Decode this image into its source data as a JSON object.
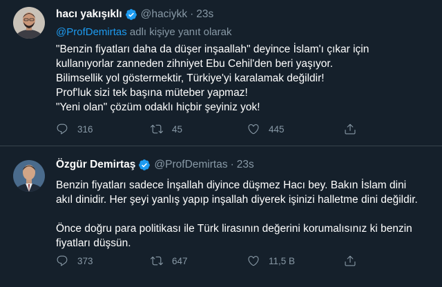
{
  "tweets": [
    {
      "name": "hacı yakışıklı",
      "handle": "@haciykk",
      "separator": "·",
      "time": "23s",
      "replying_to": {
        "mention": "@ProfDemirtas",
        "suffix": " adlı kişiye yanıt olarak"
      },
      "lines": [
        "\"Benzin fiyatları daha da düşer inşaallah\" deyince İslam'ı çıkar için",
        "kullanıyorlar zanneden zihniyet Ebu Cehil'den beri yaşıyor.",
        "Bilimsellik yol göstermektir, Türkiye'yi karalamak değildir!",
        "Prof'luk sizi tek başına müteber yapmaz!",
        "\"Yeni olan\" çözüm odaklı hiçbir şeyiniz yok!"
      ],
      "actions": {
        "replies": "316",
        "retweets": "45",
        "likes": "445"
      }
    },
    {
      "name": "Özgür Demirtaş",
      "handle": "@ProfDemirtas",
      "separator": "·",
      "time": "23s",
      "lines": [
        "Benzin fiyatları sadece İnşallah diyince düşmez Hacı bey. Bakın İslam dini",
        "akıl dinidir. Her şeyi yanlış yapıp inşallah diyerek işinizi halletme dini değildir.",
        "",
        "Önce doğru para politikası ile Türk lirasının değerini korumalısınız ki benzin",
        "fiyatları düşsün."
      ],
      "actions": {
        "replies": "373",
        "retweets": "647",
        "likes": "11,5 B"
      }
    }
  ],
  "colors": {
    "background": "#15202b",
    "text": "#ffffff",
    "secondary": "#8899a6",
    "link": "#1d9bf0",
    "verified": "#1d9bf0",
    "divider": "#38444d"
  },
  "icons": [
    "verified-badge-icon",
    "reply-icon",
    "retweet-icon",
    "like-icon",
    "share-icon"
  ]
}
